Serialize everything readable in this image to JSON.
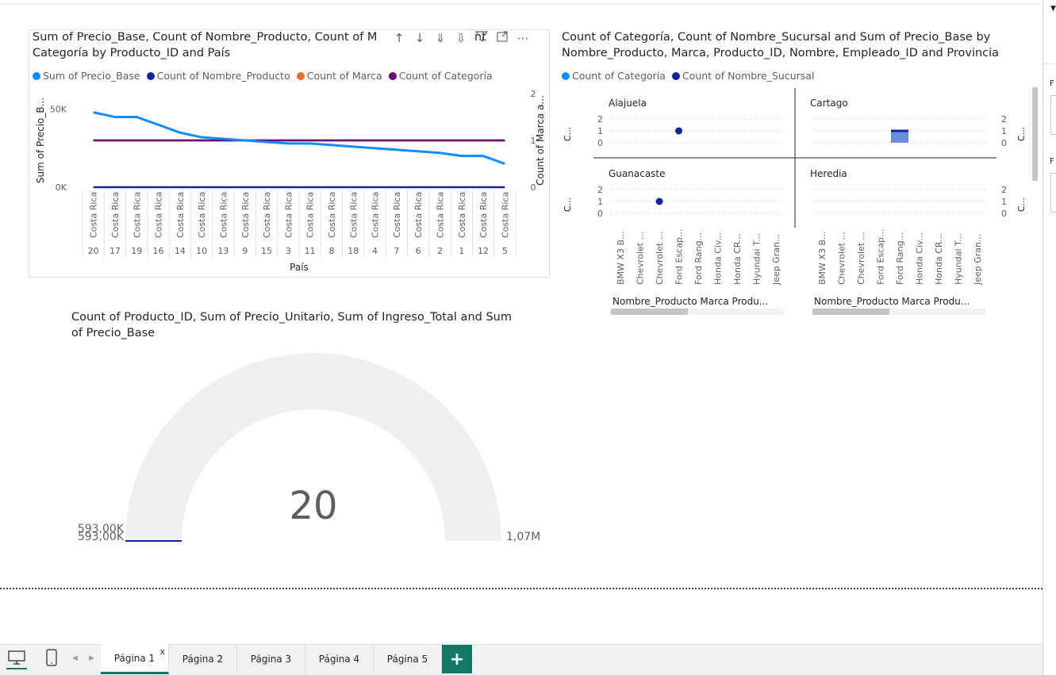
{
  "line_chart": {
    "title_line1": "Sum of Precio_Base, Count of Nombre_Producto, Count of M",
    "title_line1_tail": "nt",
    "title_line2": "Categoría by Producto_ID and País",
    "legend": [
      {
        "label": "Sum of Precio_Base",
        "color": "#118DFF"
      },
      {
        "label": "Count of Nombre_Producto",
        "color": "#12239E"
      },
      {
        "label": "Count of Marca",
        "color": "#E66C37"
      },
      {
        "label": "Count of Categoría",
        "color": "#6B007B"
      }
    ],
    "y_left_label": "Sum of Precio_B...",
    "y_right_label": "Count of Marca a...",
    "x_label": "País",
    "y_left_ticks": [
      "50K",
      "0K"
    ],
    "y_right_ticks": [
      "2",
      "1",
      "0"
    ]
  },
  "chart_data": [
    {
      "type": "line",
      "categories": [
        "Costa Rica 20",
        "Costa Rica 17",
        "Costa Rica 19",
        "Costa Rica 16",
        "Costa Rica 14",
        "Costa Rica 10",
        "Costa Rica 13",
        "Costa Rica 9",
        "Costa Rica 15",
        "Costa Rica 3",
        "Costa Rica 11",
        "Costa Rica 8",
        "Costa Rica 18",
        "Costa Rica 4",
        "Costa Rica 7",
        "Costa Rica 6",
        "Costa Rica 2",
        "Costa Rica 1",
        "Costa Rica 12",
        "Costa Rica 5"
      ],
      "x_country": "Costa Rica",
      "x_ids": [
        "20",
        "17",
        "19",
        "16",
        "14",
        "10",
        "13",
        "9",
        "15",
        "3",
        "11",
        "8",
        "18",
        "4",
        "7",
        "6",
        "2",
        "1",
        "12",
        "5"
      ],
      "series": [
        {
          "name": "Sum of Precio_Base",
          "axis": "left",
          "values": [
            48000,
            45000,
            45000,
            40000,
            35000,
            32000,
            31000,
            30000,
            29000,
            28000,
            28000,
            27000,
            26000,
            25000,
            24000,
            23000,
            22000,
            20000,
            20000,
            15000
          ]
        },
        {
          "name": "Count of Nombre_Producto",
          "axis": "left",
          "values": [
            0,
            0,
            0,
            0,
            0,
            0,
            0,
            0,
            0,
            0,
            0,
            0,
            0,
            0,
            0,
            0,
            0,
            0,
            0,
            0
          ]
        },
        {
          "name": "Count of Marca",
          "axis": "right",
          "values": [
            1,
            1,
            1,
            1,
            1,
            1,
            1,
            1,
            1,
            1,
            1,
            1,
            1,
            1,
            1,
            1,
            1,
            1,
            1,
            1
          ]
        },
        {
          "name": "Count of Categoría",
          "axis": "right",
          "values": [
            1,
            1,
            1,
            1,
            1,
            1,
            1,
            1,
            1,
            1,
            1,
            1,
            1,
            1,
            1,
            1,
            1,
            1,
            1,
            1
          ]
        }
      ],
      "ylim_left": [
        0,
        60000
      ],
      "ylim_right": [
        0,
        2
      ],
      "xlabel": "País",
      "ylabel": "Sum of Precio_B...",
      "ylabel_right": "Count of Marca a..."
    },
    {
      "type": "scatter",
      "panels": [
        {
          "title": "Alajuela",
          "points": [
            {
              "category": "Chevrolet ...",
              "series": "Count of Nombre_Sucursal",
              "value": 1
            }
          ]
        },
        {
          "title": "Cartago",
          "points": [
            {
              "category": "Ford Rang...",
              "series": "Count of Nombre_Sucursal",
              "value": 1
            }
          ]
        },
        {
          "title": "Guanacaste",
          "points": [
            {
              "category": "Chevrolet ...",
              "series": "Count of Nombre_Sucursal",
              "value": 1
            }
          ]
        },
        {
          "title": "Heredia",
          "points": []
        }
      ],
      "categories": [
        "BMW X3 B...",
        "Chevrolet ...",
        "Chevrolet ...",
        "Ford Escap...",
        "Ford Rang...",
        "Honda Civ...",
        "Honda CR...",
        "Hyundai T...",
        "Jeep Gran..."
      ],
      "ylim": [
        0,
        2
      ],
      "y_ticks": [
        "2",
        "1",
        "0"
      ]
    },
    {
      "type": "gauge",
      "value": 20,
      "min_label": "593,00K",
      "min_label_2": "593,00K",
      "max_label": "1,07M"
    }
  ],
  "small_multiples": {
    "title_line1": "Count of Categoría, Count of Nombre_Sucursal and Sum of Precio_Base by",
    "title_line2": "Nombre_Producto, Marca, Producto_ID, Nombre, Empleado_ID and Provincia",
    "legend": [
      {
        "label": "Count of Categoría",
        "color": "#118DFF"
      },
      {
        "label": "Count of Nombre_Sucursal",
        "color": "#12239E"
      }
    ],
    "y_label": "C...",
    "x_title": "Nombre_Producto Marca Produ..."
  },
  "gauge": {
    "title_line1": "Count of Producto_ID, Sum of Precio_Unitario, Sum of Ingreso_Total and Sum",
    "title_line2": "of Precio_Base",
    "value_label": "20"
  },
  "tabs": [
    {
      "label": "Página 1",
      "active": true,
      "close": "x"
    },
    {
      "label": "Página 2"
    },
    {
      "label": "Página 3"
    },
    {
      "label": "Página 4"
    },
    {
      "label": "Página 5"
    }
  ],
  "add_tab_label": "+",
  "side_labels": [
    "F",
    "F"
  ]
}
